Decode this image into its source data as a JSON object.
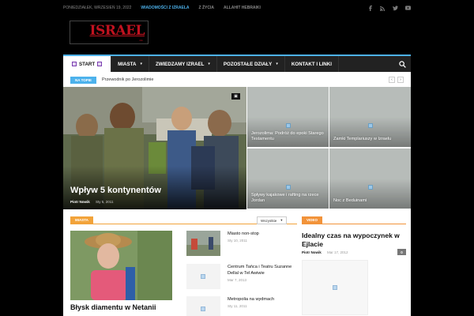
{
  "topbar": {
    "date": "PONIEDZIAŁEK, WRZESIEŃ 19, 2022",
    "links": [
      "WIADOMOŚCI Z IZRAELA",
      "Z ŻYCIA",
      "ALLAHIT HEBRAIKI"
    ],
    "social_icons": [
      "facebook-icon",
      "rss-icon",
      "twitter-icon",
      "youtube-icon"
    ]
  },
  "logo": {
    "text": "ISRAEL",
    "sub": "info"
  },
  "nav": {
    "items": [
      {
        "label": "START",
        "caret": "▾"
      },
      {
        "label": "MIASTA",
        "caret": "▾"
      },
      {
        "label": "ZWIEDZAMY IZRAEL",
        "caret": "▾"
      },
      {
        "label": "POZOSTAŁE DZIAŁY",
        "caret": "▾"
      },
      {
        "label": "KONTAKT I LINKI",
        "caret": ""
      }
    ],
    "search_icon": "⌕"
  },
  "ticker": {
    "badge": "NA TOPIE",
    "text": "Przewodnik po Jerozolimie",
    "prev": "‹",
    "next": "›"
  },
  "featured": {
    "main": {
      "title": "Wpływ 5 kontynentów",
      "author": "Piotr Nowik",
      "date": "Sty 5, 2011",
      "camera": "▣"
    },
    "small": [
      {
        "title": "Jerozolima: Podróż do epoki Starego Testamentu"
      },
      {
        "title": "Zamki Templariuszy w Izraelu"
      },
      {
        "title": "Spływy kajakowe i rafting na rzece Jordan"
      },
      {
        "title": "Noc z Beduinami"
      }
    ]
  },
  "sections": {
    "miasta": {
      "badge": "MIASTA",
      "filter": "Wszystkie",
      "filter_caret": "▾",
      "big_title": "Błysk diamentu w Netanii",
      "list": [
        {
          "title": "Miasto non-stop",
          "date": "Sty 10, 2011"
        },
        {
          "title": "Centrum Tańca i Teatru Suzanne Dellal w Tel Awiwie",
          "date": "Mar 7, 2013"
        },
        {
          "title": "Metropolia na wydmach",
          "date": "Sty 11, 2011"
        }
      ]
    },
    "video": {
      "badge": "VIDEO",
      "title": "Idealny czas na wypoczynek w Ejlacie",
      "author": "Piotr Nowik",
      "date": "Mar 17, 2012",
      "count": "0"
    }
  },
  "colors": {
    "accent": "#4db2ec",
    "miasta": "#f2a33a",
    "video": "#f2933a",
    "nav_bg": "#222222"
  }
}
